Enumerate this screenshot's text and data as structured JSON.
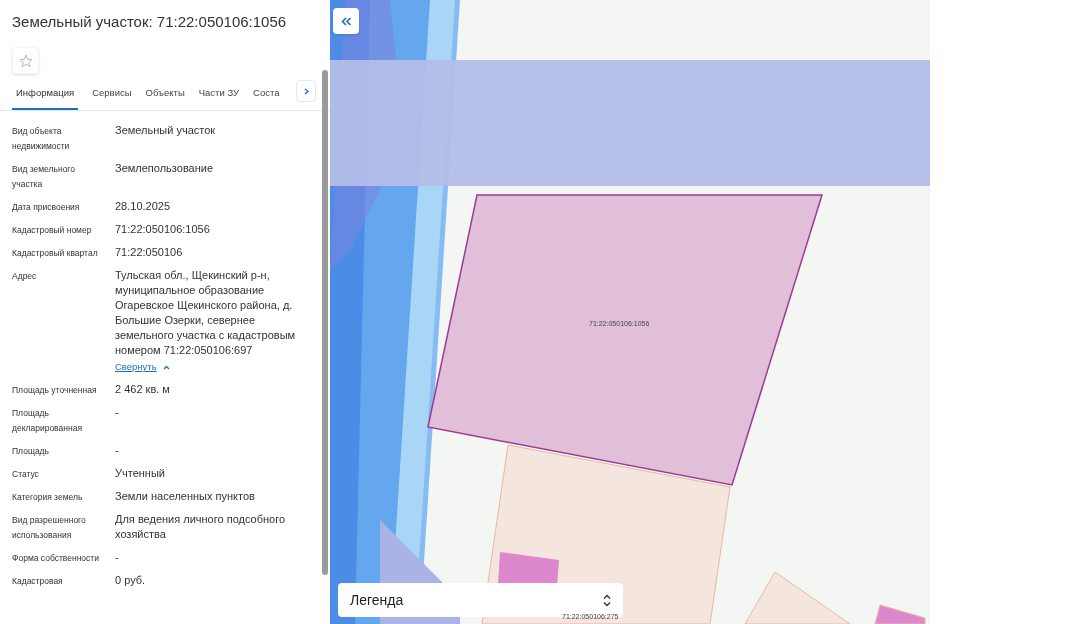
{
  "panel": {
    "title": "Земельный участок: 71:22:050106:1056",
    "favorite": {
      "on": false
    },
    "tabs": [
      {
        "label": "Информация",
        "selected": true
      },
      {
        "label": "Сервисы",
        "selected": false
      },
      {
        "label": "Объекты",
        "selected": false
      },
      {
        "label": "Части ЗУ",
        "selected": false
      },
      {
        "label": "Соста",
        "selected": false
      }
    ],
    "fields": [
      {
        "label": "Вид объекта недвижимости",
        "value": "Земельный участок"
      },
      {
        "label": "Вид земельного участка",
        "value": "Землепользование"
      },
      {
        "label": "Дата присвоения",
        "value": "28.10.2025"
      },
      {
        "label": "Кадастровый номер",
        "value": "71:22:050106:1056"
      },
      {
        "label": "Кадастровый квартал",
        "value": "71:22:050106"
      },
      {
        "label": "Адрес",
        "value": "Тульская обл., Щекинский р-н, муниципальное образование Огаревское Щекинского района, д. Большие Озерки, севернее земельного участка с кадастровым номером 71:22:050106:697",
        "link": "Свернуть"
      },
      {
        "label": "Площадь уточненная",
        "value": "2 462 кв. м"
      },
      {
        "label": "Площадь декларированная",
        "value": "-"
      },
      {
        "label": "Площадь",
        "value": "-"
      },
      {
        "label": "Статус",
        "value": "Учтенный"
      },
      {
        "label": "Категория земель",
        "value": "Земли населенных пунктов"
      },
      {
        "label": "Вид разрешенного использования",
        "value": "Для ведения личного подсобного хозяйства"
      },
      {
        "label": "Форма собственности",
        "value": "-"
      },
      {
        "label": "Кадастровая",
        "value": "0 руб."
      }
    ]
  },
  "map": {
    "parcel_labels": [
      "71:22:050106:1056",
      "71:22:050106:275"
    ],
    "legend": "Легенда"
  }
}
